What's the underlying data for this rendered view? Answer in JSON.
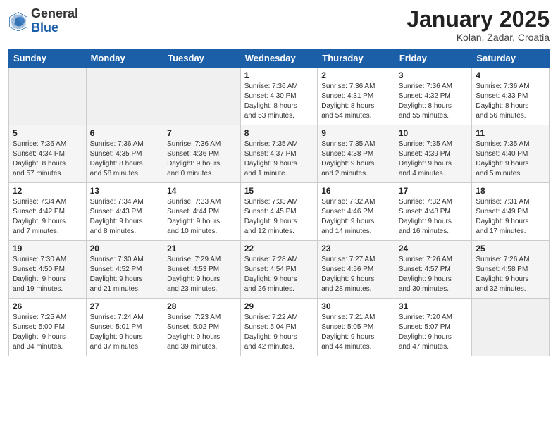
{
  "header": {
    "logo": {
      "general": "General",
      "blue": "Blue"
    },
    "title": "January 2025",
    "subtitle": "Kolan, Zadar, Croatia"
  },
  "weekdays": [
    "Sunday",
    "Monday",
    "Tuesday",
    "Wednesday",
    "Thursday",
    "Friday",
    "Saturday"
  ],
  "weeks": [
    [
      {
        "day": "",
        "info": ""
      },
      {
        "day": "",
        "info": ""
      },
      {
        "day": "",
        "info": ""
      },
      {
        "day": "1",
        "info": "Sunrise: 7:36 AM\nSunset: 4:30 PM\nDaylight: 8 hours\nand 53 minutes."
      },
      {
        "day": "2",
        "info": "Sunrise: 7:36 AM\nSunset: 4:31 PM\nDaylight: 8 hours\nand 54 minutes."
      },
      {
        "day": "3",
        "info": "Sunrise: 7:36 AM\nSunset: 4:32 PM\nDaylight: 8 hours\nand 55 minutes."
      },
      {
        "day": "4",
        "info": "Sunrise: 7:36 AM\nSunset: 4:33 PM\nDaylight: 8 hours\nand 56 minutes."
      }
    ],
    [
      {
        "day": "5",
        "info": "Sunrise: 7:36 AM\nSunset: 4:34 PM\nDaylight: 8 hours\nand 57 minutes."
      },
      {
        "day": "6",
        "info": "Sunrise: 7:36 AM\nSunset: 4:35 PM\nDaylight: 8 hours\nand 58 minutes."
      },
      {
        "day": "7",
        "info": "Sunrise: 7:36 AM\nSunset: 4:36 PM\nDaylight: 9 hours\nand 0 minutes."
      },
      {
        "day": "8",
        "info": "Sunrise: 7:35 AM\nSunset: 4:37 PM\nDaylight: 9 hours\nand 1 minute."
      },
      {
        "day": "9",
        "info": "Sunrise: 7:35 AM\nSunset: 4:38 PM\nDaylight: 9 hours\nand 2 minutes."
      },
      {
        "day": "10",
        "info": "Sunrise: 7:35 AM\nSunset: 4:39 PM\nDaylight: 9 hours\nand 4 minutes."
      },
      {
        "day": "11",
        "info": "Sunrise: 7:35 AM\nSunset: 4:40 PM\nDaylight: 9 hours\nand 5 minutes."
      }
    ],
    [
      {
        "day": "12",
        "info": "Sunrise: 7:34 AM\nSunset: 4:42 PM\nDaylight: 9 hours\nand 7 minutes."
      },
      {
        "day": "13",
        "info": "Sunrise: 7:34 AM\nSunset: 4:43 PM\nDaylight: 9 hours\nand 8 minutes."
      },
      {
        "day": "14",
        "info": "Sunrise: 7:33 AM\nSunset: 4:44 PM\nDaylight: 9 hours\nand 10 minutes."
      },
      {
        "day": "15",
        "info": "Sunrise: 7:33 AM\nSunset: 4:45 PM\nDaylight: 9 hours\nand 12 minutes."
      },
      {
        "day": "16",
        "info": "Sunrise: 7:32 AM\nSunset: 4:46 PM\nDaylight: 9 hours\nand 14 minutes."
      },
      {
        "day": "17",
        "info": "Sunrise: 7:32 AM\nSunset: 4:48 PM\nDaylight: 9 hours\nand 16 minutes."
      },
      {
        "day": "18",
        "info": "Sunrise: 7:31 AM\nSunset: 4:49 PM\nDaylight: 9 hours\nand 17 minutes."
      }
    ],
    [
      {
        "day": "19",
        "info": "Sunrise: 7:30 AM\nSunset: 4:50 PM\nDaylight: 9 hours\nand 19 minutes."
      },
      {
        "day": "20",
        "info": "Sunrise: 7:30 AM\nSunset: 4:52 PM\nDaylight: 9 hours\nand 21 minutes."
      },
      {
        "day": "21",
        "info": "Sunrise: 7:29 AM\nSunset: 4:53 PM\nDaylight: 9 hours\nand 23 minutes."
      },
      {
        "day": "22",
        "info": "Sunrise: 7:28 AM\nSunset: 4:54 PM\nDaylight: 9 hours\nand 26 minutes."
      },
      {
        "day": "23",
        "info": "Sunrise: 7:27 AM\nSunset: 4:56 PM\nDaylight: 9 hours\nand 28 minutes."
      },
      {
        "day": "24",
        "info": "Sunrise: 7:26 AM\nSunset: 4:57 PM\nDaylight: 9 hours\nand 30 minutes."
      },
      {
        "day": "25",
        "info": "Sunrise: 7:26 AM\nSunset: 4:58 PM\nDaylight: 9 hours\nand 32 minutes."
      }
    ],
    [
      {
        "day": "26",
        "info": "Sunrise: 7:25 AM\nSunset: 5:00 PM\nDaylight: 9 hours\nand 34 minutes."
      },
      {
        "day": "27",
        "info": "Sunrise: 7:24 AM\nSunset: 5:01 PM\nDaylight: 9 hours\nand 37 minutes."
      },
      {
        "day": "28",
        "info": "Sunrise: 7:23 AM\nSunset: 5:02 PM\nDaylight: 9 hours\nand 39 minutes."
      },
      {
        "day": "29",
        "info": "Sunrise: 7:22 AM\nSunset: 5:04 PM\nDaylight: 9 hours\nand 42 minutes."
      },
      {
        "day": "30",
        "info": "Sunrise: 7:21 AM\nSunset: 5:05 PM\nDaylight: 9 hours\nand 44 minutes."
      },
      {
        "day": "31",
        "info": "Sunrise: 7:20 AM\nSunset: 5:07 PM\nDaylight: 9 hours\nand 47 minutes."
      },
      {
        "day": "",
        "info": ""
      }
    ]
  ]
}
